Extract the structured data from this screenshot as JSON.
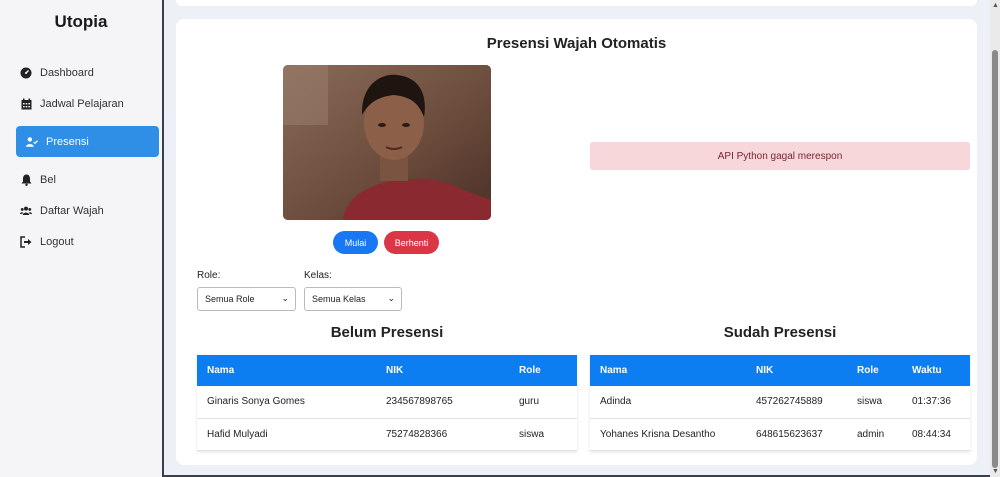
{
  "app": {
    "brand": "Utopia"
  },
  "sidebar": {
    "items": [
      {
        "label": "Dashboard",
        "icon": "dashboard-icon"
      },
      {
        "label": "Jadwal Pelajaran",
        "icon": "calendar-icon"
      },
      {
        "label": "Presensi",
        "icon": "user-check-icon",
        "active": true
      },
      {
        "label": "Bel",
        "icon": "bell-icon"
      },
      {
        "label": "Daftar Wajah",
        "icon": "users-icon"
      },
      {
        "label": "Logout",
        "icon": "logout-icon"
      }
    ]
  },
  "main": {
    "title": "Presensi Wajah Otomatis",
    "buttons": {
      "start": "Mulai",
      "stop": "Berhenti"
    },
    "alert": "API Python gagal merespon",
    "filters": {
      "role_label": "Role:",
      "role_value": "Semua Role",
      "kelas_label": "Kelas:",
      "kelas_value": "Semua Kelas"
    },
    "belum": {
      "title": "Belum Presensi",
      "headers": [
        "Nama",
        "NIK",
        "Role"
      ],
      "rows": [
        [
          "Ginaris Sonya Gomes",
          "234567898765",
          "guru"
        ],
        [
          "Hafid Mulyadi",
          "75274828366",
          "siswa"
        ]
      ]
    },
    "sudah": {
      "title": "Sudah Presensi",
      "headers": [
        "Nama",
        "NIK",
        "Role",
        "Waktu"
      ],
      "rows": [
        [
          "Adinda",
          "457262745889",
          "siswa",
          "01:37:36"
        ],
        [
          "Yohanes Krisna Desantho",
          "648615623637",
          "admin",
          "08:44:34"
        ]
      ]
    }
  },
  "colors": {
    "primary": "#1877f2",
    "table_header": "#0d7ef2",
    "danger": "#dc3545",
    "alert_bg": "#f8d7da",
    "sidebar_active": "#2f8ee5"
  }
}
